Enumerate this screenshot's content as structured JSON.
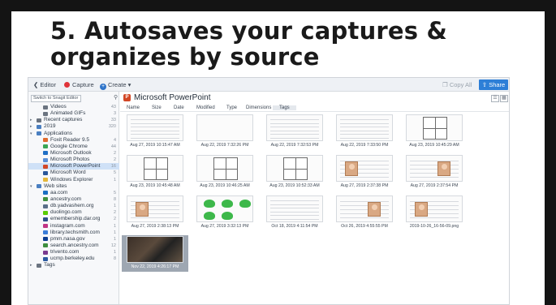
{
  "slide": {
    "title": "5. Autosaves your captures & organizes by source"
  },
  "toolbar": {
    "back_label": "Editor",
    "capture_label": "Capture",
    "create_label": "Create",
    "copy_all_label": "Copy All",
    "share_label": "Share"
  },
  "sidebar": {
    "switch_button": "Switch to Snagit Editor",
    "items": [
      {
        "label": "Videos",
        "count": "43",
        "indent": 1
      },
      {
        "label": "Animated GIFs",
        "count": "3",
        "indent": 1
      },
      {
        "label": "Recent captures",
        "count": "33",
        "indent": 0
      },
      {
        "label": "2019",
        "count": "320",
        "indent": 0
      },
      {
        "label": "Applications",
        "count": "",
        "indent": 0
      },
      {
        "label": "Foxit Reader 9.5",
        "count": "4",
        "indent": 1
      },
      {
        "label": "Google Chrome",
        "count": "44",
        "indent": 1
      },
      {
        "label": "Microsoft Outlook",
        "count": "2",
        "indent": 1
      },
      {
        "label": "Microsoft Photos",
        "count": "2",
        "indent": 1
      },
      {
        "label": "Microsoft PowerPoint",
        "count": "16",
        "indent": 1
      },
      {
        "label": "Microsoft Word",
        "count": "5",
        "indent": 1
      },
      {
        "label": "Windows Explorer",
        "count": "1",
        "indent": 1
      },
      {
        "label": "Web sites",
        "count": "",
        "indent": 0
      },
      {
        "label": "aa.com",
        "count": "5",
        "indent": 1
      },
      {
        "label": "ancestry.com",
        "count": "8",
        "indent": 1
      },
      {
        "label": "db.yadvashem.org",
        "count": "1",
        "indent": 1
      },
      {
        "label": "duolingo.com",
        "count": "2",
        "indent": 1
      },
      {
        "label": "emembership.dar.org",
        "count": "2",
        "indent": 1
      },
      {
        "label": "instagram.com",
        "count": "1",
        "indent": 1
      },
      {
        "label": "library.techsmith.com",
        "count": "1",
        "indent": 1
      },
      {
        "label": "pmm.nasa.gov",
        "count": "1",
        "indent": 1
      },
      {
        "label": "search.ancestry.com",
        "count": "12",
        "indent": 1
      },
      {
        "label": "trivento.com",
        "count": "1",
        "indent": 1
      },
      {
        "label": "ucmp.berkeley.edu",
        "count": "8",
        "indent": 1
      },
      {
        "label": "Tags",
        "count": "",
        "indent": 0
      }
    ],
    "selected_index": 9
  },
  "main": {
    "breadcrumb": "Microsoft PowerPoint",
    "columns": [
      "Name",
      "Size",
      "Date",
      "Modified",
      "Type",
      "Dimensions",
      "Tags"
    ],
    "captures": [
      {
        "caption": "Aug 27, 2019 10:15:47 AM",
        "kind": "doc"
      },
      {
        "caption": "Aug 22, 2019 7:32:26 PM",
        "kind": "blank"
      },
      {
        "caption": "Aug 22, 2019 7:32:53 PM",
        "kind": "doc"
      },
      {
        "caption": "Aug 22, 2019 7:33:50 PM",
        "kind": "doc"
      },
      {
        "caption": "Aug 23, 2019 10:45:29 AM",
        "kind": "grid"
      },
      {
        "caption": "Aug 23, 2019 10:45:48 AM",
        "kind": "grid"
      },
      {
        "caption": "Aug 23, 2019 10:46:25 AM",
        "kind": "grid"
      },
      {
        "caption": "Aug 23, 2019 10:52:33 AM",
        "kind": "grid"
      },
      {
        "caption": "Aug 27, 2019 2:37:38 PM",
        "kind": "photo"
      },
      {
        "caption": "Aug 27, 2019 2:37:54 PM",
        "kind": "photo"
      },
      {
        "caption": "Aug 27, 2019 2:38:13 PM",
        "kind": "photo"
      },
      {
        "caption": "Aug 27, 2019 3:32:13 PM",
        "kind": "green"
      },
      {
        "caption": "Oct 18, 2019 4:11:54 PM",
        "kind": "doc"
      },
      {
        "caption": "Oct 26, 2019 4:55:55 PM",
        "kind": "photo"
      },
      {
        "caption": "2019-10-26_16-56-09.png",
        "kind": "photo"
      },
      {
        "caption": "Nov 22, 2019 4:26:17 PM",
        "kind": "dark",
        "selected": true
      }
    ]
  }
}
